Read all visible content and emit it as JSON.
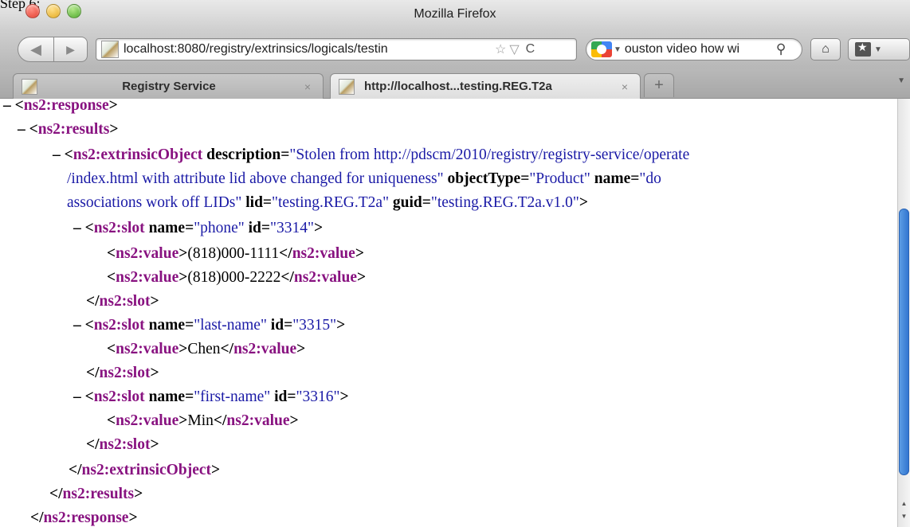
{
  "document": {
    "fragment": "Step 6:"
  },
  "window": {
    "title": "Mozilla Firefox"
  },
  "toolbar": {
    "back_icon": "◀",
    "forward_icon": "▶",
    "url": "localhost:8080/registry/extrinsics/logicals/testin",
    "bookmark_star_icon": "☆",
    "url_dropdown_icon": "▽",
    "reload_icon": "C",
    "search_text": "ouston video how wi",
    "search_engine_dropdown_icon": "▼",
    "search_glass_icon": "⚲",
    "home_icon": "⌂",
    "bookmarks_dropdown_icon": "▼"
  },
  "tabs": [
    {
      "label": "Registry Service",
      "close": "×",
      "active": false
    },
    {
      "label": "http://localhost...testing.REG.T2a",
      "close": "×",
      "active": true
    }
  ],
  "newtab_icon": "+",
  "tablist_icon": "▼",
  "xml": {
    "l1": {
      "toggle": "–",
      "open": "<",
      "tag": "ns2:response",
      "close": ">"
    },
    "l2": {
      "toggle": "–",
      "open": "<",
      "tag": "ns2:results",
      "close": ">"
    },
    "l3": {
      "toggle": "–",
      "open": "<",
      "tag": "ns2:extrinsicObject",
      "a1_name": "description",
      "eq": "=",
      "a1_val_part1": "\"Stolen from http://pdscm/2010/registry/registry-service/operate",
      "a1_val_part2": "/index.html with attribute lid above changed for uniqueness\"",
      "a2_name": "objectType",
      "a2_val": "\"Product\"",
      "a3_name": "name",
      "a3_val_part1": "\"do",
      "a3_val_part2": "associations work off LIDs\"",
      "a4_name": "lid",
      "a4_val": "\"testing.REG.T2a\"",
      "a5_name": "guid",
      "a5_val": "\"testing.REG.T2a.v1.0\"",
      "close": ">"
    },
    "slot1": {
      "toggle": "–",
      "tag": "ns2:slot",
      "name_attr": "name",
      "name_val": "\"phone\"",
      "id_attr": "id",
      "id_val": "\"3314\"",
      "values": [
        "(818)000-1111",
        "(818)000-2222"
      ]
    },
    "slot2": {
      "toggle": "–",
      "tag": "ns2:slot",
      "name_attr": "name",
      "name_val": "\"last-name\"",
      "id_attr": "id",
      "id_val": "\"3315\"",
      "values": [
        "Chen"
      ]
    },
    "slot3": {
      "toggle": "–",
      "tag": "ns2:slot",
      "name_attr": "name",
      "name_val": "\"first-name\"",
      "id_attr": "id",
      "id_val": "\"3316\"",
      "values": [
        "Min"
      ]
    },
    "value_tag": "ns2:value",
    "slot_end": "ns2:slot",
    "extrinsic_end": "ns2:extrinsicObject",
    "results_end": "ns2:results",
    "response_end": "ns2:response"
  },
  "scrollbar": {
    "up_icon": "▲",
    "down_icon": "▼"
  }
}
